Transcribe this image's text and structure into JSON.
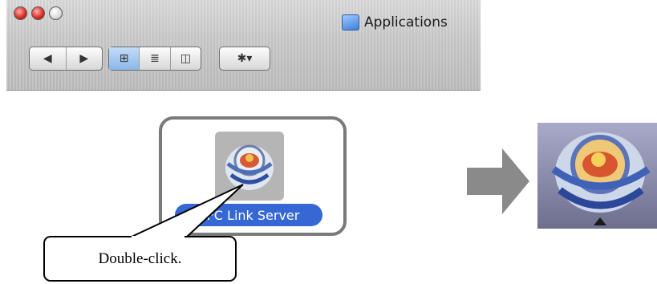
{
  "window": {
    "title": "Applications",
    "traffic_lights": [
      "close",
      "minimize",
      "zoom"
    ]
  },
  "toolbar": {
    "back_icon": "◀",
    "forward_icon": "▶",
    "view_icon_glyph": "⊞",
    "view_list_glyph": "≣",
    "view_column_glyph": "◫",
    "action_glyph": "✱▾"
  },
  "content": {
    "app_label": "AFC Link Server"
  },
  "callout": {
    "text": "Double-click."
  },
  "colors": {
    "selection_blue": "#3568d4",
    "frame_gray": "#7a7a7a",
    "arrow_gray": "#8a8a8a"
  }
}
